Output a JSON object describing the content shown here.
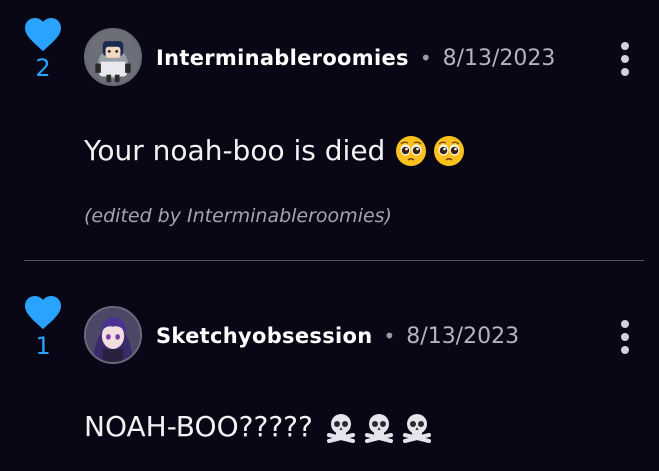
{
  "colors": {
    "background": "#090716",
    "like_blue": "#2aa3ff",
    "divider": "#55556a"
  },
  "comments": [
    {
      "like_count": "2",
      "username": "Interminableroomies",
      "separator": "•",
      "date": "8/13/2023",
      "text": "Your noah-boo is died",
      "emojis": [
        "pleading-face-emoji",
        "pleading-face-emoji"
      ],
      "edited_note": "(edited by Interminableroomies)",
      "avatar_icon": "robot-character-avatar"
    },
    {
      "like_count": "1",
      "username": "Sketchyobsession",
      "separator": "•",
      "date": "8/13/2023",
      "text": "NOAH-BOO?????",
      "emojis": [
        "skull-crossbones-emoji",
        "skull-crossbones-emoji",
        "skull-crossbones-emoji"
      ],
      "avatar_icon": "anime-character-avatar"
    }
  ]
}
